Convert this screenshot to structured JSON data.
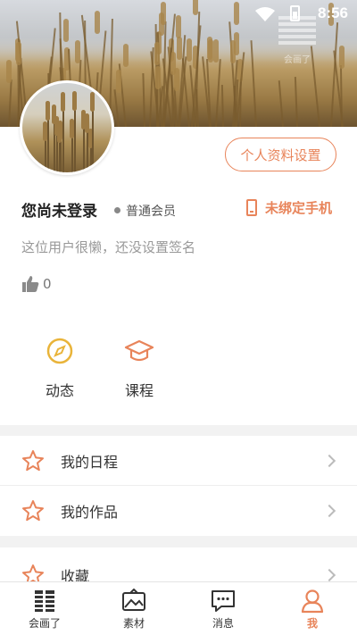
{
  "status_bar": {
    "time": "8:56"
  },
  "watermark": {
    "text": "会画了"
  },
  "profile": {
    "settings_button": "个人资料设置",
    "username": "您尚未登录",
    "member_level": "普通会员",
    "phone_status": "未绑定手机",
    "signature": "这位用户很懒，还没设置签名",
    "likes": "0"
  },
  "quick_actions": [
    {
      "label": "动态",
      "icon": "compass-icon"
    },
    {
      "label": "课程",
      "icon": "graduation-cap-icon"
    }
  ],
  "menu": {
    "group1": [
      {
        "label": "我的日程",
        "icon": "star-icon"
      },
      {
        "label": "我的作品",
        "icon": "star-icon"
      }
    ],
    "group2": [
      {
        "label": "收藏",
        "icon": "star-icon"
      }
    ]
  },
  "bottom_nav": [
    {
      "label": "会画了",
      "icon": "app-logo-icon",
      "active": false
    },
    {
      "label": "素材",
      "icon": "image-frame-icon",
      "active": false
    },
    {
      "label": "消息",
      "icon": "message-icon",
      "active": false
    },
    {
      "label": "我",
      "icon": "user-icon",
      "active": true
    }
  ],
  "colors": {
    "accent": "#e8845a",
    "compass": "#e9b43a"
  }
}
